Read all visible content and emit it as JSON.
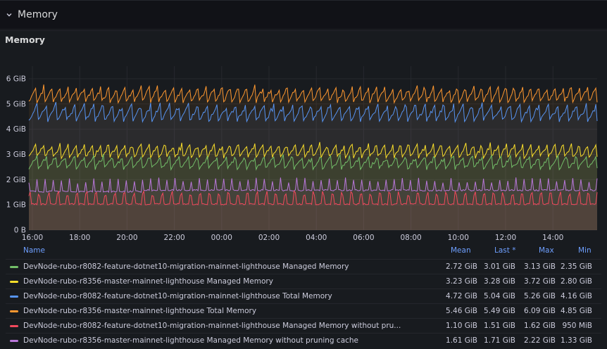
{
  "row": {
    "title": "Memory",
    "collapse_icon": "chevron-down-icon"
  },
  "panel": {
    "title": "Memory"
  },
  "legend": {
    "headers": {
      "name": "Name",
      "mean": "Mean",
      "last": "Last *",
      "max": "Max",
      "min": "Min"
    },
    "rows": [
      {
        "name": "DevNode-rubo-r8082-feature-dotnet10-migration-mainnet-lighthouse Managed Memory",
        "color": "#73bf69",
        "mean": "2.72 GiB",
        "last": "3.01 GiB",
        "max": "3.13 GiB",
        "min": "2.35 GiB"
      },
      {
        "name": "DevNode-rubo-r8356-master-mainnet-lighthouse Managed Memory",
        "color": "#fade2a",
        "mean": "3.23 GiB",
        "last": "3.28 GiB",
        "max": "3.72 GiB",
        "min": "2.80 GiB"
      },
      {
        "name": "DevNode-rubo-r8082-feature-dotnet10-migration-mainnet-lighthouse Total Memory",
        "color": "#5794f2",
        "mean": "4.72 GiB",
        "last": "5.04 GiB",
        "max": "5.26 GiB",
        "min": "4.16 GiB"
      },
      {
        "name": "DevNode-rubo-r8356-master-mainnet-lighthouse Total Memory",
        "color": "#ff9830",
        "mean": "5.46 GiB",
        "last": "5.49 GiB",
        "max": "6.09 GiB",
        "min": "4.85 GiB"
      },
      {
        "name": "DevNode-rubo-r8082-feature-dotnet10-migration-mainnet-lighthouse Managed Memory without pru...",
        "color": "#f2495c",
        "mean": "1.10 GiB",
        "last": "1.51 GiB",
        "max": "1.62 GiB",
        "min": "950 MiB"
      },
      {
        "name": "DevNode-rubo-r8356-master-mainnet-lighthouse Managed Memory without pruning cache",
        "color": "#b877d9",
        "mean": "1.61 GiB",
        "last": "1.71 GiB",
        "max": "2.22 GiB",
        "min": "1.33 GiB"
      }
    ]
  },
  "chart_data": {
    "type": "line",
    "y_unit": "GiB",
    "y_ticks": [
      "0 B",
      "1 GiB",
      "2 GiB",
      "3 GiB",
      "4 GiB",
      "5 GiB",
      "6 GiB"
    ],
    "ylim": [
      0,
      6.5
    ],
    "x_ticks": [
      "16:00",
      "18:00",
      "20:00",
      "22:00",
      "00:00",
      "02:00",
      "04:00",
      "06:00",
      "08:00",
      "10:00",
      "12:00",
      "14:00"
    ],
    "grid": true,
    "legend_placement": "bottom",
    "fill": true,
    "series": [
      {
        "name": "DevNode-rubo-r8356-master-mainnet-lighthouse Total Memory",
        "color": "#ff9830",
        "base": 5.1,
        "amp": 0.75,
        "min": 4.85,
        "max": 6.09
      },
      {
        "name": "DevNode-rubo-r8082-feature-dotnet10-migration-mainnet-lighthouse Total Memory",
        "color": "#5794f2",
        "base": 4.35,
        "amp": 0.8,
        "min": 4.16,
        "max": 5.26
      },
      {
        "name": "DevNode-rubo-r8356-master-mainnet-lighthouse Managed Memory",
        "color": "#fade2a",
        "base": 2.9,
        "amp": 0.65,
        "min": 2.8,
        "max": 3.72
      },
      {
        "name": "DevNode-rubo-r8082-feature-dotnet10-migration-mainnet-lighthouse Managed Memory",
        "color": "#73bf69",
        "base": 2.45,
        "amp": 0.6,
        "min": 2.35,
        "max": 3.13
      },
      {
        "name": "DevNode-rubo-r8356-master-mainnet-lighthouse Managed Memory without pruning cache",
        "color": "#b877d9",
        "base": 1.5,
        "amp": 0.55,
        "min": 1.33,
        "max": 2.22
      },
      {
        "name": "DevNode-rubo-r8082-feature-dotnet10-migration-mainnet-lighthouse Managed Memory without pruning cache",
        "color": "#f2495c",
        "base": 1.0,
        "amp": 0.55,
        "min": 0.93,
        "max": 1.62
      }
    ]
  }
}
